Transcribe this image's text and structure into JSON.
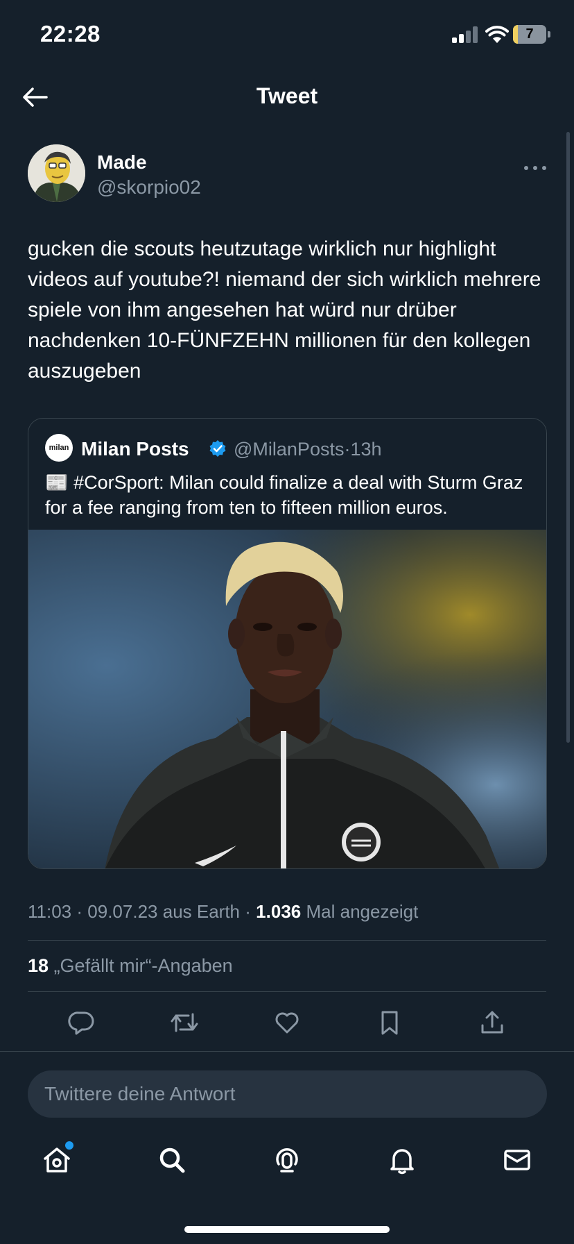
{
  "status_bar": {
    "time": "22:28",
    "battery_level": "7",
    "battery_fraction": 0.14
  },
  "header": {
    "title": "Tweet"
  },
  "tweet": {
    "author": {
      "display_name": "Made",
      "handle": "@skorpio02"
    },
    "text": "gucken die scouts heutzutage wirklich nur highlight videos auf youtube?! niemand der sich wirklich mehrere spiele von ihm angesehen hat würd nur drüber nachdenken 10-FÜNFZEHN millionen für den kollegen auszugeben"
  },
  "quote": {
    "avatar_text": "milan",
    "name": "Milan Posts",
    "handle": "@MilanPosts",
    "separator": "·",
    "age": "13h",
    "text": "📰 #CorSport: Milan could finalize a deal with Sturm Graz for a fee ranging from ten to fifteen million euros."
  },
  "meta": {
    "time": "11:03",
    "date": "09.07.23",
    "source": "aus Earth",
    "sep": "·",
    "views": "1.036",
    "views_label": "Mal angezeigt"
  },
  "likes": {
    "count": "18",
    "label": "„Gefällt mir“-Angaben"
  },
  "actions": [
    "reply-icon",
    "retweet-icon",
    "like-icon",
    "bookmark-icon",
    "share-icon"
  ],
  "reply": {
    "placeholder": "Twittere deine Antwort"
  },
  "tabbar": [
    "home-icon",
    "search-icon",
    "spaces-icon",
    "notifications-icon",
    "messages-icon"
  ],
  "colors": {
    "background": "#15202b",
    "secondary_text": "#8b98a5",
    "border": "#38444d",
    "accent": "#1d9bf0"
  }
}
